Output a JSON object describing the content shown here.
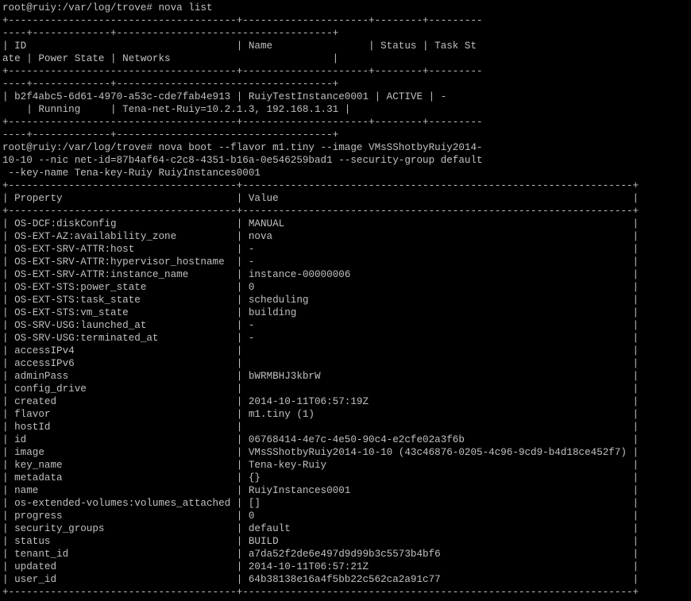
{
  "terminal": {
    "lines": [
      "root@ruiy:/var/log/trove# nova list",
      "+--------------------------------------+---------------------+--------+---------",
      "----+-------------+------------------------------------+",
      "| ID                                   | Name                | Status | Task St",
      "ate | Power State | Networks                           |",
      "+--------------------------------------+---------------------+--------+---------",
      "----+-------------+------------------------------------+",
      "| b2f4abc5-6d61-4970-a53c-cde7fab4e913 | RuiyTestInstance0001 | ACTIVE | -",
      "    | Running     | Tena-net-Ruiy=10.2.1.3, 192.168.1.31 |",
      "+--------------------------------------+---------------------+--------+---------",
      "----+-------------+------------------------------------+",
      "root@ruiy:/var/log/trove# nova boot --flavor m1.tiny --image VMsSShotbyRuiy2014-",
      "10-10 --nic net-id=87b4af64-c2c8-4351-b16a-0e546259bad1 --security-group default",
      " --key-name Tena-key-Ruiy RuiyInstances0001",
      "+--------------------------------------+-----------------------------------------------------------------+",
      "| Property                             | Value                                                           |",
      "+--------------------------------------+-----------------------------------------------------------------+",
      "| OS-DCF:diskConfig                    | MANUAL                                                          |",
      "| OS-EXT-AZ:availability_zone          | nova                                                            |",
      "| OS-EXT-SRV-ATTR:host                 | -                                                               |",
      "| OS-EXT-SRV-ATTR:hypervisor_hostname  | -                                                               |",
      "| OS-EXT-SRV-ATTR:instance_name        | instance-00000006                                               |",
      "| OS-EXT-STS:power_state               | 0                                                               |",
      "| OS-EXT-STS:task_state                | scheduling                                                      |",
      "| OS-EXT-STS:vm_state                  | building                                                        |",
      "| OS-SRV-USG:launched_at               | -                                                               |",
      "| OS-SRV-USG:terminated_at             | -                                                               |",
      "| accessIPv4                           |                                                                 |",
      "| accessIPv6                           |                                                                 |",
      "| adminPass                            | bWRMBHJ3kbrW                                                    |",
      "| config_drive                         |                                                                 |",
      "| created                              | 2014-10-11T06:57:19Z                                            |",
      "| flavor                               | m1.tiny (1)                                                     |",
      "| hostId                               |                                                                 |",
      "| id                                   | 06768414-4e7c-4e50-90c4-e2cfe02a3f6b                            |",
      "| image                                | VMsSShotbyRuiy2014-10-10 (43c46876-0205-4c96-9cd9-b4d18ce452f7) |",
      "| key_name                             | Tena-key-Ruiy                                                   |",
      "| metadata                             | {}                                                              |",
      "| name                                 | RuiyInstances0001                                               |",
      "| os-extended-volumes:volumes_attached | []                                                              |",
      "| progress                             | 0                                                               |",
      "| security_groups                      | default                                                         |",
      "| status                               | BUILD                                                           |",
      "| tenant_id                            | a7da52f2de6e497d9d99b3c5573b4bf6                                |",
      "| updated                              | 2014-10-11T06:57:21Z                                            |",
      "| user_id                              | 64b38138e16a4f5bb22c562ca2a91c77                                |",
      "+--------------------------------------+-----------------------------------------------------------------+"
    ]
  },
  "colors": {
    "background": "#000000",
    "foreground": "#c0c0c0"
  }
}
